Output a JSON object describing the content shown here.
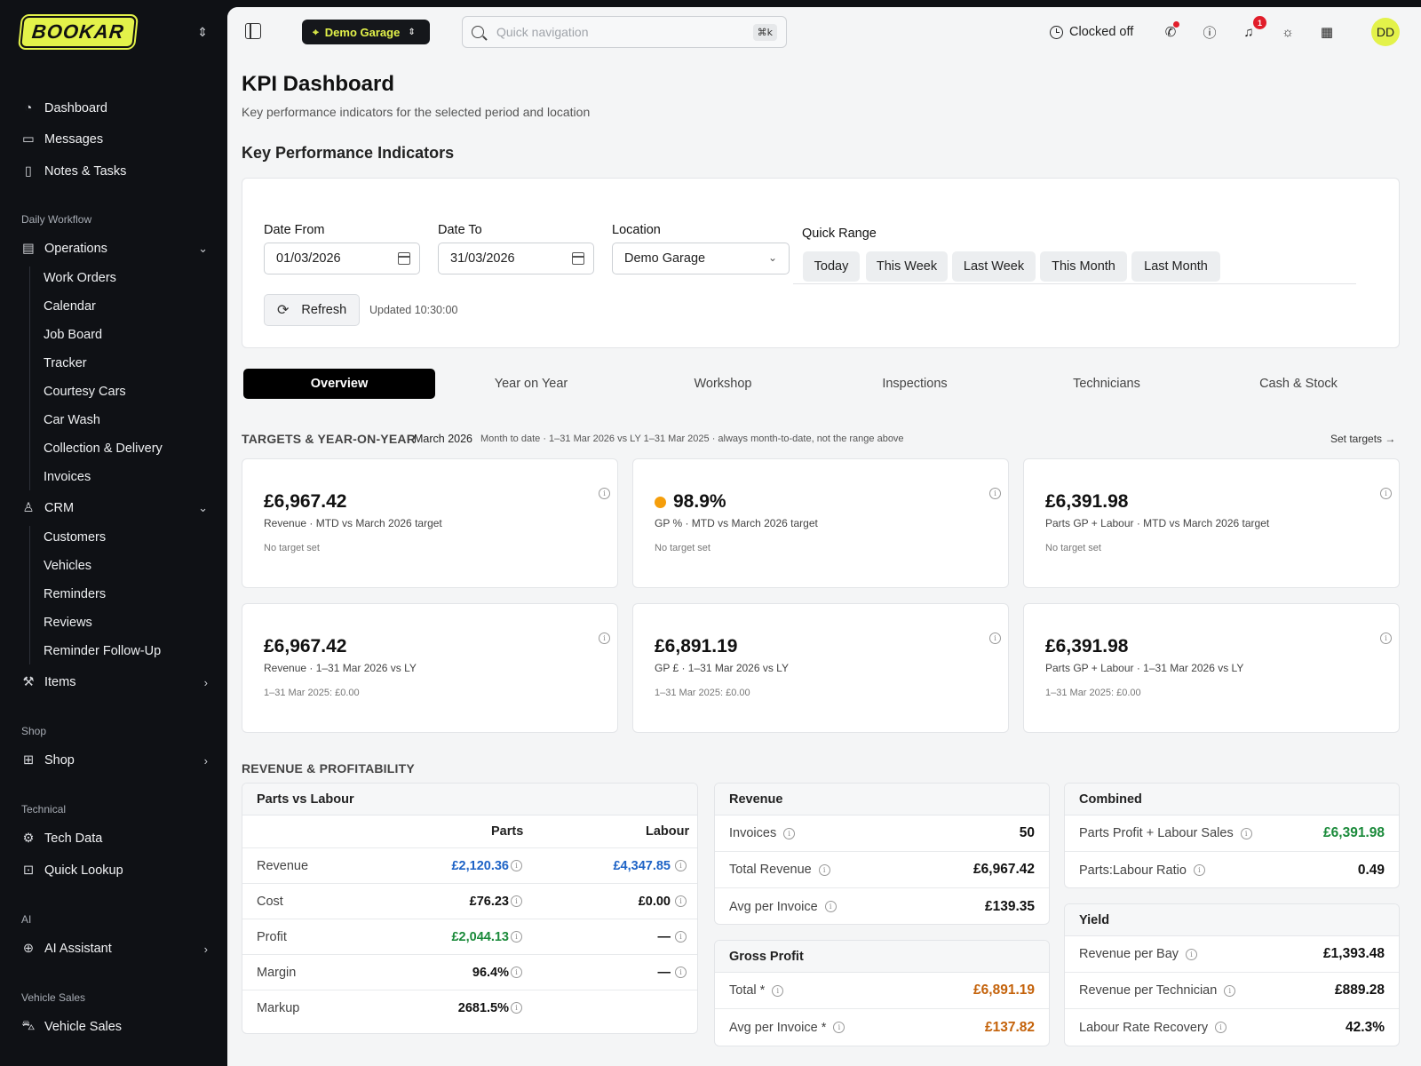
{
  "brand": "BOOKAR",
  "sidebar": {
    "top_items": [
      {
        "label": "Dashboard",
        "icon": "gauge-icon"
      },
      {
        "label": "Messages",
        "icon": "message-icon"
      },
      {
        "label": "Notes & Tasks",
        "icon": "note-icon"
      }
    ],
    "sections": {
      "daily_workflow": "Daily Workflow",
      "shop": "Shop",
      "technical": "Technical",
      "ai": "AI",
      "vehicle_sales": "Vehicle Sales"
    },
    "operations": {
      "label": "Operations",
      "children": [
        "Work Orders",
        "Calendar",
        "Job Board",
        "Tracker",
        "Courtesy Cars",
        "Car Wash",
        "Collection & Delivery",
        "Invoices"
      ]
    },
    "crm": {
      "label": "CRM",
      "children": [
        "Customers",
        "Vehicles",
        "Reminders",
        "Reviews",
        "Reminder Follow-Up"
      ]
    },
    "items": "Items",
    "shop": "Shop",
    "tech_data": "Tech Data",
    "quick_lookup": "Quick Lookup",
    "ai_assistant": "AI Assistant",
    "vehicle_sales": "Vehicle Sales"
  },
  "topbar": {
    "garage": "Demo Garage",
    "search_placeholder": "Quick navigation",
    "shortcut": "⌘k",
    "clock_status": "Clocked off",
    "notification_count": "1",
    "avatar": "DD"
  },
  "page": {
    "title": "KPI Dashboard",
    "subtitle": "Key performance indicators for the selected period and location",
    "kpi_heading": "Key Performance Indicators"
  },
  "filters": {
    "date_from_label": "Date From",
    "date_from": "01/03/2026",
    "date_to_label": "Date To",
    "date_to": "31/03/2026",
    "location_label": "Location",
    "location": "Demo Garage",
    "quick_range_label": "Quick Range",
    "quick_range": [
      "Today",
      "This Week",
      "Last Week",
      "This Month",
      "Last Month"
    ],
    "refresh": "Refresh",
    "updated": "Updated 10:30:00"
  },
  "tabs": [
    "Overview",
    "Year on Year",
    "Workshop",
    "Inspections",
    "Technicians",
    "Cash & Stock"
  ],
  "targets": {
    "title": "TARGETS & YEAR-ON-YEAR",
    "month": "March 2026",
    "note": "Month to date · 1–31 Mar 2026 vs LY 1–31 Mar 2025 · always month-to-date, not the range above",
    "set_targets": "Set targets →",
    "cards": [
      {
        "value": "£6,967.42",
        "desc": "Revenue · MTD vs March 2026 target",
        "note": "No target set"
      },
      {
        "value": "98.9%",
        "desc": "GP % · MTD vs March 2026 target",
        "note": "No target set",
        "status_color": "#f59e0b"
      },
      {
        "value": "£6,391.98",
        "desc": "Parts GP + Labour · MTD vs March 2026 target",
        "note": "No target set"
      },
      {
        "value": "£6,967.42",
        "desc": "Revenue · 1–31 Mar 2026 vs LY",
        "note": "1–31 Mar 2025: £0.00"
      },
      {
        "value": "£6,891.19",
        "desc": "GP £ · 1–31 Mar 2026 vs LY",
        "note": "1–31 Mar 2025: £0.00"
      },
      {
        "value": "£6,391.98",
        "desc": "Parts GP + Labour · 1–31 Mar 2026 vs LY",
        "note": "1–31 Mar 2025: £0.00"
      }
    ]
  },
  "revenue_section": {
    "title": "REVENUE & PROFITABILITY",
    "parts_vs_labour": {
      "title": "Parts vs Labour",
      "col_parts": "Parts",
      "col_labour": "Labour",
      "rows": [
        {
          "label": "Revenue",
          "parts": "£2,120.36",
          "labour": "£4,347.85"
        },
        {
          "label": "Cost",
          "parts": "£76.23",
          "labour": "£0.00"
        },
        {
          "label": "Profit",
          "parts": "£2,044.13",
          "labour": "—"
        },
        {
          "label": "Margin",
          "parts": "96.4%",
          "labour": "—"
        },
        {
          "label": "Markup",
          "parts": "2681.5%",
          "labour": ""
        }
      ]
    },
    "revenue": {
      "title": "Revenue",
      "rows": [
        {
          "label": "Invoices",
          "value": "50"
        },
        {
          "label": "Total Revenue",
          "value": "£6,967.42"
        },
        {
          "label": "Avg per Invoice",
          "value": "£139.35"
        }
      ]
    },
    "gross_profit": {
      "title": "Gross Profit",
      "rows": [
        {
          "label": "Total *",
          "value": "£6,891.19"
        },
        {
          "label": "Avg per Invoice *",
          "value": "£137.82"
        }
      ]
    },
    "combined": {
      "title": "Combined",
      "rows": [
        {
          "label": "Parts Profit + Labour Sales",
          "value": "£6,391.98"
        },
        {
          "label": "Parts:Labour Ratio",
          "value": "0.49"
        }
      ]
    },
    "yield": {
      "title": "Yield",
      "rows": [
        {
          "label": "Revenue per Bay",
          "value": "£1,393.48"
        },
        {
          "label": "Revenue per Technician",
          "value": "£889.28"
        },
        {
          "label": "Labour Rate Recovery",
          "value": "42.3%"
        }
      ]
    }
  },
  "colors": {
    "brand": "#e3f24a",
    "positive": "#1a8a3a",
    "link": "#1e63c6",
    "gross_profit": "#c4620a",
    "alert": "#e11d2a"
  }
}
